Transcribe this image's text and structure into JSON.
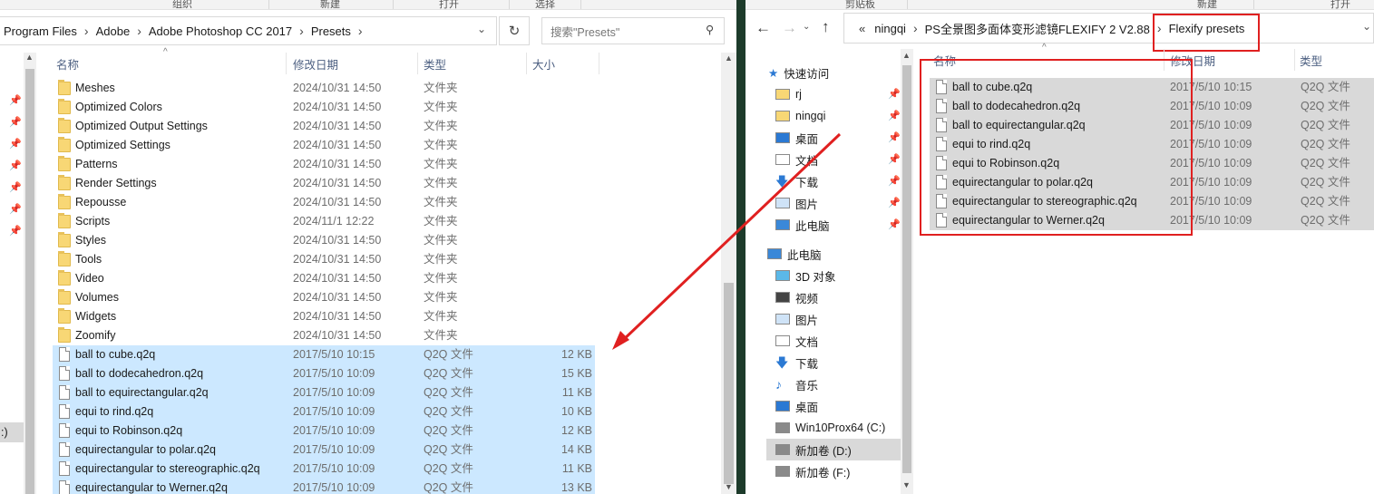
{
  "colors": {
    "selection": "#cce8ff",
    "gray_selection": "#d9d9d9",
    "annotation_red": "#e02020",
    "header_blue": "#4d6082"
  },
  "left": {
    "ribbon_tabs": [
      "组织",
      "新建",
      "打开",
      "选择"
    ],
    "breadcrumb": [
      "Program Files",
      "Adobe",
      "Adobe Photoshop CC 2017",
      "Presets"
    ],
    "search_placeholder": "搜索\"Presets\"",
    "columns": {
      "name": "名称",
      "date": "修改日期",
      "type": "类型",
      "size": "大小"
    },
    "folders": [
      {
        "name": "Meshes",
        "date": "2024/10/31 14:50",
        "type": "文件夹"
      },
      {
        "name": "Optimized Colors",
        "date": "2024/10/31 14:50",
        "type": "文件夹"
      },
      {
        "name": "Optimized Output Settings",
        "date": "2024/10/31 14:50",
        "type": "文件夹"
      },
      {
        "name": "Optimized Settings",
        "date": "2024/10/31 14:50",
        "type": "文件夹"
      },
      {
        "name": "Patterns",
        "date": "2024/10/31 14:50",
        "type": "文件夹"
      },
      {
        "name": "Render Settings",
        "date": "2024/10/31 14:50",
        "type": "文件夹"
      },
      {
        "name": "Repousse",
        "date": "2024/10/31 14:50",
        "type": "文件夹"
      },
      {
        "name": "Scripts",
        "date": "2024/11/1 12:22",
        "type": "文件夹"
      },
      {
        "name": "Styles",
        "date": "2024/10/31 14:50",
        "type": "文件夹"
      },
      {
        "name": "Tools",
        "date": "2024/10/31 14:50",
        "type": "文件夹"
      },
      {
        "name": "Video",
        "date": "2024/10/31 14:50",
        "type": "文件夹"
      },
      {
        "name": "Volumes",
        "date": "2024/10/31 14:50",
        "type": "文件夹"
      },
      {
        "name": "Widgets",
        "date": "2024/10/31 14:50",
        "type": "文件夹"
      },
      {
        "name": "Zoomify",
        "date": "2024/10/31 14:50",
        "type": "文件夹"
      }
    ],
    "files": [
      {
        "name": "ball to cube.q2q",
        "date": "2017/5/10 10:15",
        "type": "Q2Q 文件",
        "size": "12 KB"
      },
      {
        "name": "ball to dodecahedron.q2q",
        "date": "2017/5/10 10:09",
        "type": "Q2Q 文件",
        "size": "15 KB"
      },
      {
        "name": "ball to equirectangular.q2q",
        "date": "2017/5/10 10:09",
        "type": "Q2Q 文件",
        "size": "11 KB"
      },
      {
        "name": "equi to rind.q2q",
        "date": "2017/5/10 10:09",
        "type": "Q2Q 文件",
        "size": "10 KB"
      },
      {
        "name": "equi to Robinson.q2q",
        "date": "2017/5/10 10:09",
        "type": "Q2Q 文件",
        "size": "12 KB"
      },
      {
        "name": "equirectangular to polar.q2q",
        "date": "2017/5/10 10:09",
        "type": "Q2Q 文件",
        "size": "14 KB"
      },
      {
        "name": "equirectangular to stereographic.q2q",
        "date": "2017/5/10 10:09",
        "type": "Q2Q 文件",
        "size": "11 KB"
      },
      {
        "name": "equirectangular to Werner.q2q",
        "date": "2017/5/10 10:09",
        "type": "Q2Q 文件",
        "size": "13 KB"
      }
    ],
    "nav_fragment": ":)"
  },
  "right": {
    "ribbon_tabs": [
      "剪贴板",
      "新建",
      "打开"
    ],
    "breadcrumb": [
      "«",
      "ningqi",
      "PS全景图多面体变形滤镜FLEXIFY 2 V2.88",
      "Flexify presets"
    ],
    "columns": {
      "name": "名称",
      "date": "修改日期",
      "type": "类型"
    },
    "quick_access_label": "快速访问",
    "quick_access": [
      {
        "label": "rj",
        "icon": "folder-icon"
      },
      {
        "label": "ningqi",
        "icon": "folder-icon"
      },
      {
        "label": "桌面",
        "icon": "desktop-icon"
      },
      {
        "label": "文档",
        "icon": "document-icon"
      },
      {
        "label": "下载",
        "icon": "download-icon"
      },
      {
        "label": "图片",
        "icon": "picture-icon"
      },
      {
        "label": "此电脑",
        "icon": "computer-icon"
      }
    ],
    "this_pc_label": "此电脑",
    "this_pc": [
      {
        "label": "3D 对象",
        "icon": "cube-icon"
      },
      {
        "label": "视频",
        "icon": "video-icon"
      },
      {
        "label": "图片",
        "icon": "picture-icon"
      },
      {
        "label": "文档",
        "icon": "document-icon"
      },
      {
        "label": "下载",
        "icon": "download-icon"
      },
      {
        "label": "音乐",
        "icon": "music-icon"
      },
      {
        "label": "桌面",
        "icon": "desktop-icon"
      },
      {
        "label": "Win10Prox64 (C:)",
        "icon": "drive-icon"
      },
      {
        "label": "新加卷 (D:)",
        "icon": "drive-icon"
      },
      {
        "label": "新加卷 (F:)",
        "icon": "drive-icon"
      }
    ],
    "files": [
      {
        "name": "ball to cube.q2q",
        "date": "2017/5/10 10:15",
        "type": "Q2Q 文件"
      },
      {
        "name": "ball to dodecahedron.q2q",
        "date": "2017/5/10 10:09",
        "type": "Q2Q 文件"
      },
      {
        "name": "ball to equirectangular.q2q",
        "date": "2017/5/10 10:09",
        "type": "Q2Q 文件"
      },
      {
        "name": "equi to rind.q2q",
        "date": "2017/5/10 10:09",
        "type": "Q2Q 文件"
      },
      {
        "name": "equi to Robinson.q2q",
        "date": "2017/5/10 10:09",
        "type": "Q2Q 文件"
      },
      {
        "name": "equirectangular to polar.q2q",
        "date": "2017/5/10 10:09",
        "type": "Q2Q 文件"
      },
      {
        "name": "equirectangular to stereographic.q2q",
        "date": "2017/5/10 10:09",
        "type": "Q2Q 文件"
      },
      {
        "name": "equirectangular to Werner.q2q",
        "date": "2017/5/10 10:09",
        "type": "Q2Q 文件"
      }
    ]
  }
}
